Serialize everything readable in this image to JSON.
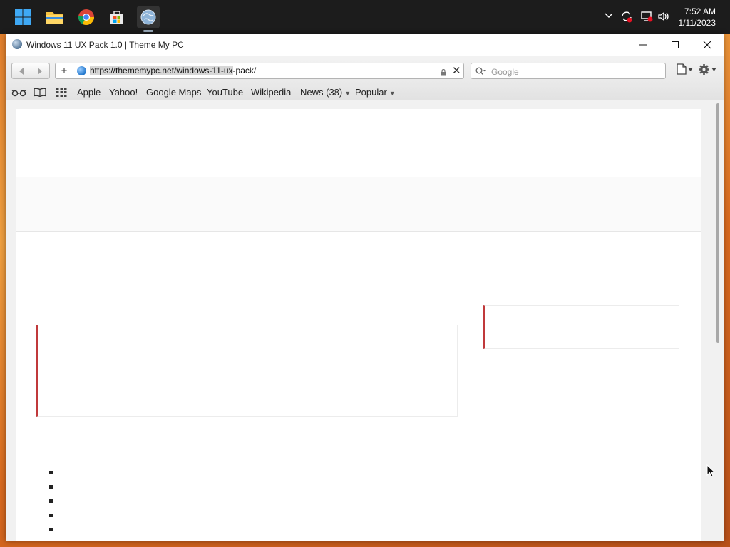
{
  "taskbar": {
    "apps": [
      {
        "name": "windows-start-icon",
        "active": false
      },
      {
        "name": "file-explorer-icon",
        "active": false
      },
      {
        "name": "chrome-icon",
        "active": false
      },
      {
        "name": "microsoft-store-icon",
        "active": false
      },
      {
        "name": "browser-app-icon",
        "active": true
      }
    ],
    "clock_time": "7:52 AM",
    "clock_date": "1/11/2023"
  },
  "window": {
    "title": "Windows 11 UX Pack 1.0 | Theme My PC",
    "controls": {
      "minimize": "—",
      "maximize": "☐",
      "close": "✕"
    }
  },
  "toolbar": {
    "url": "https://thememypc.net/windows-11-ux-pack/",
    "url_selected": "https://thememypc.net/windows-11-ux",
    "url_rest": "-pack/",
    "search_placeholder": "Google"
  },
  "bookmarks": {
    "items": [
      "Apple",
      "Yahoo!",
      "Google Maps",
      "YouTube",
      "Wikipedia",
      "News (38)",
      "Popular"
    ]
  },
  "colors": {
    "accent_border": "#c0393b",
    "taskbar_bg": "#1c1c1c"
  }
}
